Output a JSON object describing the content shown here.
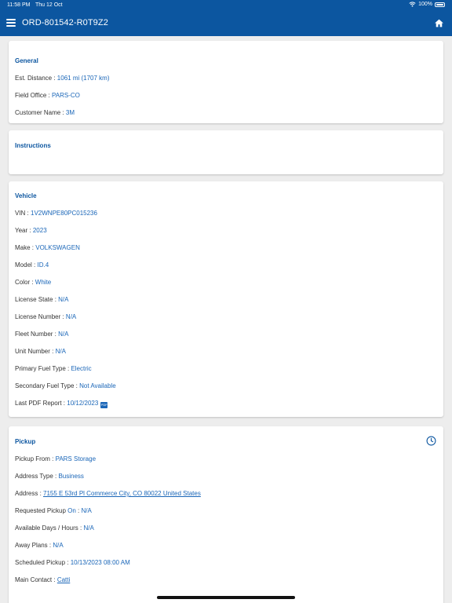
{
  "status_bar": {
    "time": "11:58 PM",
    "date": "Thu 12 Oct",
    "battery": "100%"
  },
  "header": {
    "title": "ORD-801542-R0T9Z2",
    "menu_icon": "hamburger-menu-icon",
    "home_icon": "home-icon"
  },
  "general": {
    "title": "General",
    "rows": [
      {
        "label": "Est. Distance : ",
        "value": "1061 mi (1707 km)"
      },
      {
        "label": "Field Office : ",
        "value": "PARS-CO"
      },
      {
        "label": "Customer Name : ",
        "value": "3M"
      }
    ]
  },
  "instructions": {
    "title": "Instructions"
  },
  "vehicle": {
    "title": "Vehicle",
    "rows": [
      {
        "label": "VIN : ",
        "value": "1V2WNPE80PC015236"
      },
      {
        "label": "Year : ",
        "value": "2023"
      },
      {
        "label": "Make : ",
        "value": "VOLKSWAGEN"
      },
      {
        "label": "Model : ",
        "value": "ID.4"
      },
      {
        "label": "Color : ",
        "value": "White"
      },
      {
        "label": "License State : ",
        "value": "N/A"
      },
      {
        "label": "License Number : ",
        "value": "N/A"
      },
      {
        "label": "Fleet Number : ",
        "value": "N/A"
      },
      {
        "label": "Unit Number : ",
        "value": "N/A"
      },
      {
        "label": "Primary Fuel Type : ",
        "value": "Electric"
      },
      {
        "label": "Secondary Fuel Type : ",
        "value": "Not Available"
      },
      {
        "label": "Last PDF Report : ",
        "value": "10/12/2023",
        "icon_text": "PDF"
      }
    ]
  },
  "pickup": {
    "title": "Pickup",
    "clock_icon": "clock-icon",
    "rows": [
      {
        "label": "Pickup From  : ",
        "value": "PARS Storage"
      },
      {
        "label": "Address Type : ",
        "value": "Business"
      },
      {
        "label": "Address : ",
        "value": "7155 E 53rd Pl Commerce City, CO 80022 United States"
      },
      {
        "label": "Requested Pickup ",
        "value": "On",
        "label2": " : ",
        "value2": "N/A"
      },
      {
        "label": "Available Days / Hours : ",
        "value": "N/A"
      },
      {
        "label": "Away Plans : ",
        "value": "N/A"
      },
      {
        "label": "Scheduled Pickup : ",
        "value": "10/13/2023 08:00 AM"
      },
      {
        "label": "Main Contact : ",
        "value": "Catti"
      }
    ]
  },
  "colors": {
    "primary": "#0c56a0",
    "value_text": "#1a66b8",
    "background": "#ededed"
  }
}
